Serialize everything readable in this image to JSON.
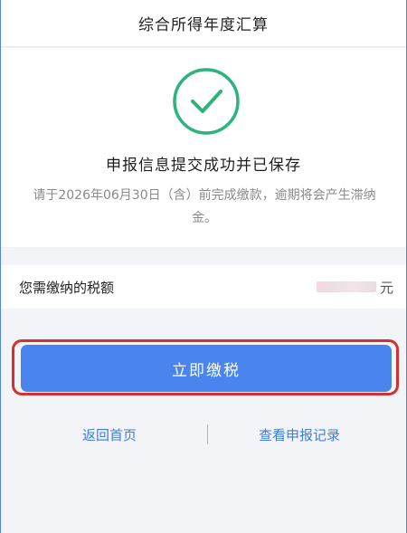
{
  "header": {
    "title": "综合所得年度汇算"
  },
  "result": {
    "icon": "check-circle-icon",
    "title": "申报信息提交成功并已保存",
    "description": "请于2026年06月30日（含）前完成缴款，逾期将会产生滞纳金。"
  },
  "tax_amount": {
    "label": "您需缴纳的税额",
    "value_obscured": true,
    "unit": "元"
  },
  "actions": {
    "pay_label": "立即缴税",
    "home_label": "返回首页",
    "records_label": "查看申报记录"
  },
  "colors": {
    "accent": "#4a84ee",
    "success": "#2fb37c",
    "highlight": "#d62f2f",
    "link": "#3f7de6"
  }
}
